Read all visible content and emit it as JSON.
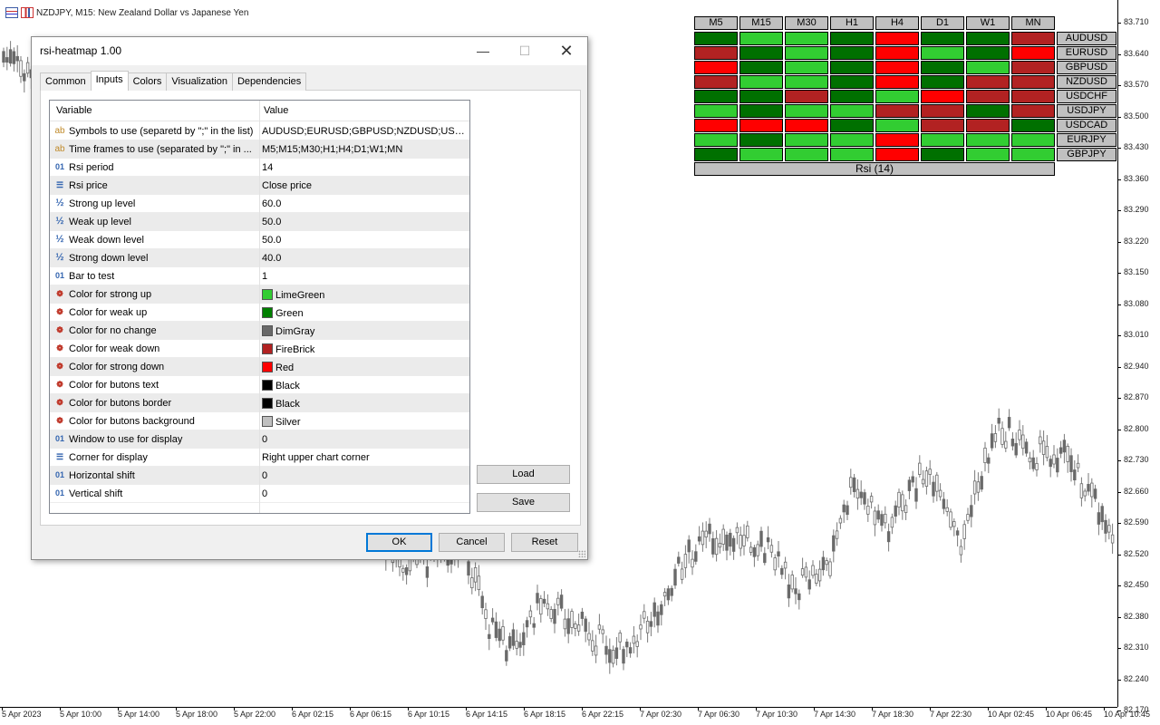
{
  "chart": {
    "symbol_line": "NZDJPY, M15:  New Zealand Dollar vs Japanese Yen",
    "price_ticks": [
      "83.710",
      "83.640",
      "83.570",
      "83.500",
      "83.430",
      "83.360",
      "83.290",
      "83.220",
      "83.150",
      "83.080",
      "83.010",
      "82.940",
      "82.870",
      "82.800",
      "82.730",
      "82.660",
      "82.590",
      "82.520",
      "82.450",
      "82.380",
      "82.310",
      "82.240",
      "82.170"
    ],
    "time_ticks": [
      "5 Apr 2023",
      "5 Apr 10:00",
      "5 Apr 14:00",
      "5 Apr 18:00",
      "5 Apr 22:00",
      "6 Apr 02:15",
      "6 Apr 06:15",
      "6 Apr 10:15",
      "6 Apr 14:15",
      "6 Apr 18:15",
      "6 Apr 22:15",
      "7 Apr 02:30",
      "7 Apr 06:30",
      "7 Apr 10:30",
      "7 Apr 14:30",
      "7 Apr 18:30",
      "7 Apr 22:30",
      "10 Apr 02:45",
      "10 Apr 06:45",
      "10 Apr 10:45"
    ]
  },
  "heatmap": {
    "timeframes": [
      "M5",
      "M15",
      "M30",
      "H1",
      "H4",
      "D1",
      "W1",
      "MN"
    ],
    "symbols": [
      "AUDUSD",
      "EURUSD",
      "GBPUSD",
      "NZDUSD",
      "USDCHF",
      "USDJPY",
      "USDCAD",
      "EURJPY",
      "GBPJPY"
    ],
    "states": [
      [
        "G",
        "L",
        "L",
        "G",
        "R",
        "G",
        "G",
        "F"
      ],
      [
        "F",
        "G",
        "L",
        "G",
        "R",
        "L",
        "G",
        "R"
      ],
      [
        "R",
        "G",
        "L",
        "G",
        "R",
        "G",
        "L",
        "F"
      ],
      [
        "F",
        "L",
        "L",
        "G",
        "R",
        "G",
        "F",
        "F"
      ],
      [
        "G",
        "G",
        "F",
        "G",
        "L",
        "R",
        "F",
        "F"
      ],
      [
        "L",
        "G",
        "L",
        "L",
        "F",
        "F",
        "G",
        "F"
      ],
      [
        "R",
        "R",
        "R",
        "G",
        "L",
        "F",
        "F",
        "G"
      ],
      [
        "L",
        "G",
        "L",
        "L",
        "R",
        "L",
        "L",
        "L"
      ],
      [
        "G",
        "L",
        "L",
        "L",
        "R",
        "G",
        "L",
        "L"
      ]
    ],
    "footer": "Rsi (14)",
    "colors": {
      "L": "#32CD32",
      "G": "#007000",
      "F": "#B22222",
      "R": "#FF0000",
      "D": "#696969"
    },
    "button_bg": "#c0c0c0"
  },
  "dialog": {
    "title": "rsi-heatmap 1.00",
    "min_glyph": "—",
    "max_glyph": "☐",
    "close_glyph": "✕",
    "tabs": [
      "Common",
      "Inputs",
      "Colors",
      "Visualization",
      "Dependencies"
    ],
    "active_tab": "Inputs",
    "grid": {
      "col_variable": "Variable",
      "col_value": "Value",
      "rows": [
        {
          "icon": "ab",
          "name": "Symbols to use (separetd by \";\" in the list)",
          "value": "AUDUSD;EURUSD;GBPUSD;NZDUSD;USDCH..."
        },
        {
          "icon": "ab",
          "name": "Time frames to use (separated by \";\" in ...",
          "value": "M5;M15;M30;H1;H4;D1;W1;MN"
        },
        {
          "icon": "01",
          "name": "Rsi period",
          "value": "14"
        },
        {
          "icon": "enum",
          "name": "Rsi price",
          "value": "Close price"
        },
        {
          "icon": "half",
          "name": "Strong up level",
          "value": "60.0"
        },
        {
          "icon": "half",
          "name": "Weak up level",
          "value": "50.0"
        },
        {
          "icon": "half",
          "name": "Weak down level",
          "value": "50.0"
        },
        {
          "icon": "half",
          "name": "Strong down level",
          "value": "40.0"
        },
        {
          "icon": "01",
          "name": "Bar to test",
          "value": "1"
        },
        {
          "icon": "color",
          "name": "Color for strong up",
          "value": "LimeGreen",
          "swatch": "#32CD32"
        },
        {
          "icon": "color",
          "name": "Color for weak up",
          "value": "Green",
          "swatch": "#008000"
        },
        {
          "icon": "color",
          "name": "Color for no change",
          "value": "DimGray",
          "swatch": "#696969"
        },
        {
          "icon": "color",
          "name": "Color for weak down",
          "value": "FireBrick",
          "swatch": "#B22222"
        },
        {
          "icon": "color",
          "name": "Color for strong down",
          "value": "Red",
          "swatch": "#FF0000"
        },
        {
          "icon": "color",
          "name": "Color for butons text",
          "value": "Black",
          "swatch": "#000000"
        },
        {
          "icon": "color",
          "name": "Color for butons border",
          "value": "Black",
          "swatch": "#000000"
        },
        {
          "icon": "color",
          "name": "Color for butons background",
          "value": "Silver",
          "swatch": "#C0C0C0"
        },
        {
          "icon": "01",
          "name": "Window to use for display",
          "value": "0"
        },
        {
          "icon": "enum",
          "name": "Corner for display",
          "value": "Right upper chart corner"
        },
        {
          "icon": "01",
          "name": "Horizontal shift",
          "value": "0"
        },
        {
          "icon": "01",
          "name": "Vertical shift",
          "value": "0"
        }
      ]
    },
    "buttons": {
      "load": "Load",
      "save": "Save",
      "ok": "OK",
      "cancel": "Cancel",
      "reset": "Reset"
    }
  }
}
